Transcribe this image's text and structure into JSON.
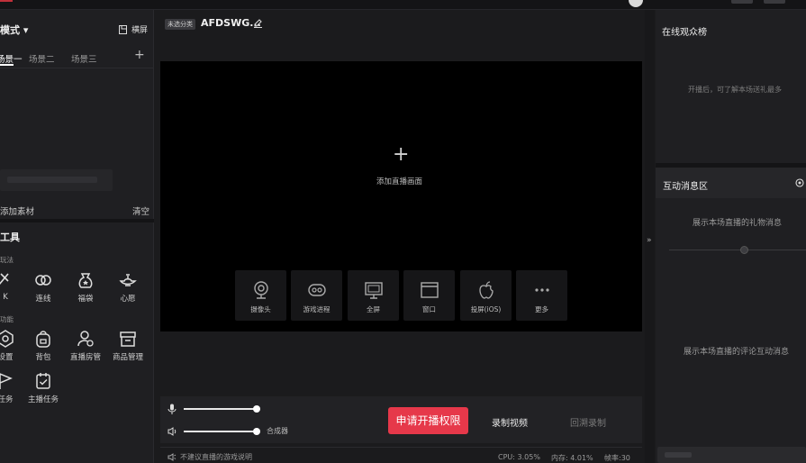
{
  "top": {
    "avatar": "avatar"
  },
  "left": {
    "mode_label": "模式 ▾",
    "landscape_label": "横屏",
    "scenes": [
      "场景一",
      "场景二",
      "场景三"
    ],
    "scene_active_index": 0,
    "add_material": "添加素材",
    "clear": "清空",
    "tools_title": "工具",
    "group1_label": "玩法",
    "group2_label": "功能",
    "tools_row1": [
      "K",
      "连线",
      "福袋",
      "心愿"
    ],
    "tools_row2": [
      "设置",
      "背包",
      "直播房管",
      "商品管理"
    ],
    "tools_row3": [
      "任务",
      "主播任务"
    ]
  },
  "center": {
    "category_badge": "未选分类",
    "room_title": "AFDSWG...",
    "stage_label": "添加直播画面",
    "sources": [
      "摄像头",
      "游戏进程",
      "全屏",
      "窗口",
      "投屏(iOS)",
      "更多"
    ],
    "mixer_label": "合成器",
    "mic_level": 1.0,
    "speaker_level": 1.0,
    "apply_button": "申请开播权限",
    "record_button": "录制视频",
    "replay_button": "回溯录制",
    "warning": "不建议直播的游戏说明",
    "cpu": "CPU: 3.05%",
    "memory": "内存: 4.01%",
    "fps": "帧率:30"
  },
  "right": {
    "audience_title": "在线观众榜",
    "audience_tip": "开播后，可了解本场送礼最多",
    "message_title": "互动消息区",
    "gift_tip": "展示本场直播的礼物消息",
    "comment_tip": "展示本场直播的评论互动消息"
  },
  "colors": {
    "accent": "#e6384a",
    "bg": "#1b1b1d",
    "panel": "#1f1f22"
  }
}
